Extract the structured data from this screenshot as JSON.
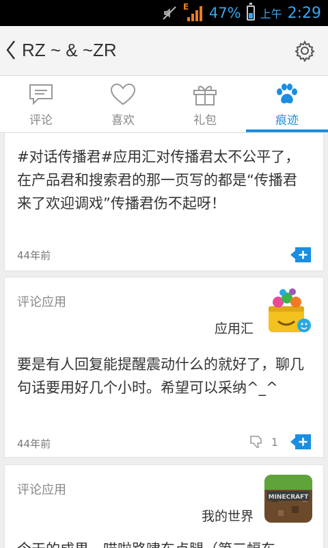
{
  "status_bar": {
    "signal_label": "E",
    "battery_percent": "47%",
    "ampm": "上午",
    "time": "2:29",
    "battery_level": 0.47
  },
  "header": {
    "title": "RZ ~ & ~ZR"
  },
  "tabs": [
    {
      "label": "评论",
      "icon": "comment-icon"
    },
    {
      "label": "喜欢",
      "icon": "heart-icon"
    },
    {
      "label": "礼包",
      "icon": "gift-icon"
    },
    {
      "label": "痕迹",
      "icon": "paw-icon",
      "active": true
    }
  ],
  "cards": [
    {
      "text": "#对话传播君#应用汇对传播君太不公平了，在产品君和搜索君的那一页写的都是“传播君来了欢迎调戏”传播君伤不起呀！",
      "time": "44年前"
    },
    {
      "label": "评论应用",
      "app_name": "应用汇",
      "text": "要是有人回复能提醒震动什么的就好了，聊几句话要用好几个小时。希望可以采纳^_^",
      "time": "44年前",
      "dislike_count": "1"
    },
    {
      "label": "评论应用",
      "app_name": "我的世界",
      "app_icon_text": "MINECRAFT",
      "text": "今天的成果，喵啦路啸东点腿（第三幅东"
    }
  ],
  "colors": {
    "accent": "#1a8ee0",
    "status_text": "#3aa6f0",
    "signal": "#f07c19"
  }
}
